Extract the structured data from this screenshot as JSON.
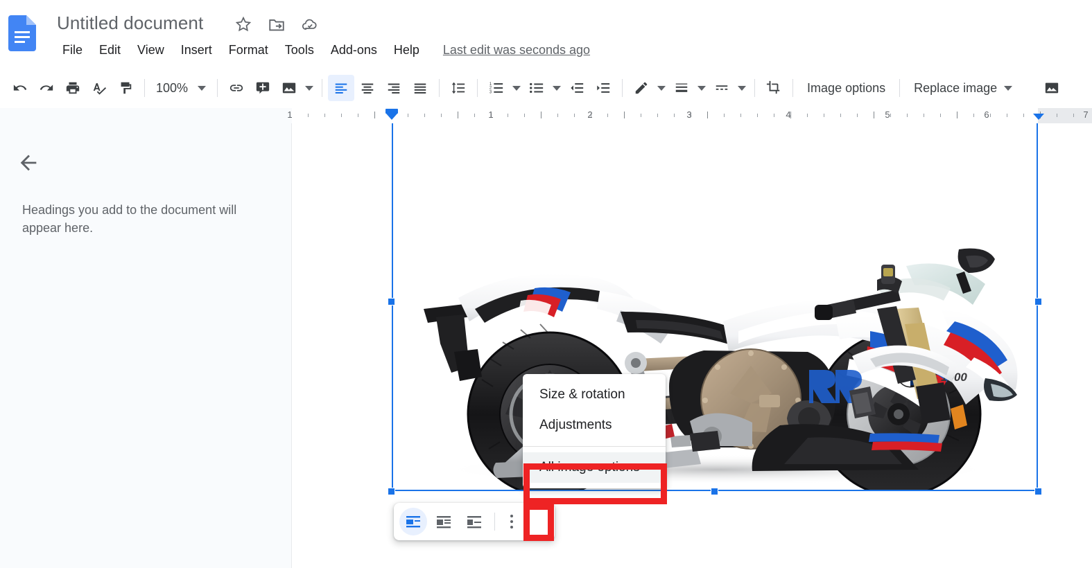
{
  "header": {
    "doc_title": "Untitled document",
    "logo_icon": "google-docs-logo",
    "title_icons": [
      {
        "name": "star-icon",
        "label": "Star"
      },
      {
        "name": "move-to-folder-icon",
        "label": "Move to folder"
      },
      {
        "name": "cloud-saved-icon",
        "label": "Saved to Drive"
      }
    ],
    "menus": [
      {
        "label": "File"
      },
      {
        "label": "Edit"
      },
      {
        "label": "View"
      },
      {
        "label": "Insert"
      },
      {
        "label": "Format"
      },
      {
        "label": "Tools"
      },
      {
        "label": "Add-ons"
      },
      {
        "label": "Help"
      }
    ],
    "last_edit": "Last edit was seconds ago"
  },
  "toolbar": {
    "undo": "Undo",
    "redo": "Redo",
    "print": "Print",
    "spelling": "Spelling and grammar check",
    "paint_format": "Paint format",
    "zoom_value": "100%",
    "insert_link": "Insert link",
    "add_comment": "Add comment",
    "insert_image": "Insert image",
    "align_left": "Left align",
    "align_center": "Center align",
    "align_right": "Right align",
    "align_justify": "Justify",
    "line_spacing": "Line & paragraph spacing",
    "numbered_list": "Numbered list",
    "bulleted_list": "Bulleted list",
    "decrease_indent": "Decrease indent",
    "increase_indent": "Increase indent",
    "border_color": "Border color",
    "border_weight": "Border weight",
    "border_dash": "Border dash",
    "crop": "Crop image",
    "image_options_label": "Image options",
    "replace_image_label": "Replace image"
  },
  "ruler": {
    "numbers": [
      "1",
      "1",
      "2",
      "3",
      "4",
      "5",
      "6",
      "7"
    ],
    "left_indent_marker": "left-indent-marker",
    "right_indent_marker": "right-indent-marker"
  },
  "sidebar": {
    "back_icon": "back-arrow-icon",
    "empty_text": "Headings you add to the document will appear here."
  },
  "image": {
    "alt": "BMW S 1000 RR motorcycle",
    "selected": true,
    "handles": [
      "middle-left",
      "middle-right",
      "bottom-left",
      "bottom-center",
      "bottom-right"
    ]
  },
  "wrap_toolbar": {
    "options": [
      {
        "name": "in-line-button",
        "label": "In line",
        "selected": true
      },
      {
        "name": "wrap-text-button",
        "label": "Wrap text",
        "selected": false
      },
      {
        "name": "break-text-button",
        "label": "Break text",
        "selected": false
      }
    ],
    "more_label": "More image options"
  },
  "dropdown": {
    "items": [
      {
        "label": "Size & rotation",
        "highlighted": false
      },
      {
        "label": "Adjustments",
        "highlighted": false
      },
      {
        "label": "All image options",
        "highlighted": true
      }
    ]
  },
  "annotations": {
    "color": "#ee2324",
    "boxes": [
      {
        "name": "all-image-options-highlight"
      },
      {
        "name": "more-options-kebab-highlight"
      }
    ]
  }
}
